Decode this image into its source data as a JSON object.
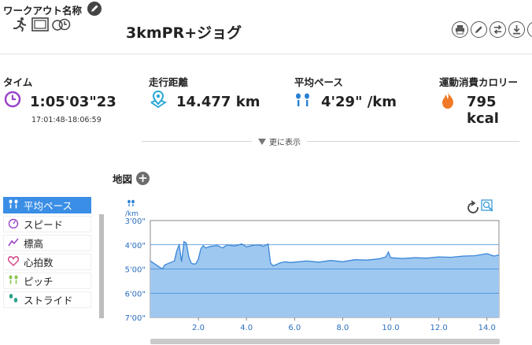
{
  "header": {
    "workout_name_label": "ワークアウト名称",
    "title": "3kmPR+ジョグ",
    "type_icons": [
      "runner-icon",
      "film-icon",
      "stopwatch-icon"
    ],
    "actions": [
      "print-icon",
      "edit-icon",
      "swap-icon",
      "download-icon",
      "share-icon"
    ]
  },
  "stats": {
    "time": {
      "label": "タイム",
      "value": "1:05'03\"23",
      "sub": "17:01:48-18:06:59",
      "icon": "clock-icon"
    },
    "distance": {
      "label": "走行距離",
      "value": "14.477 km",
      "icon": "map-pin-icon"
    },
    "pace": {
      "label": "平均ペース",
      "value": "4'29\" /km",
      "icon": "footprints-icon"
    },
    "calories": {
      "label": "運動消費カロリー",
      "value": "795 kcal",
      "icon": "flame-icon"
    }
  },
  "more_label": "更に表示",
  "map_label": "地図",
  "sidebar": {
    "items": [
      {
        "label": "平均ペース",
        "icon": "footprints-icon",
        "active": true
      },
      {
        "label": "スピード",
        "icon": "speedometer-icon",
        "active": false
      },
      {
        "label": "標高",
        "icon": "elevation-icon",
        "active": false
      },
      {
        "label": "心拍数",
        "icon": "heart-icon",
        "active": false
      },
      {
        "label": "ピッチ",
        "icon": "footprints-icon",
        "active": false
      },
      {
        "label": "ストライド",
        "icon": "stride-icon",
        "active": false
      }
    ]
  },
  "colors": {
    "accent": "#3a8ee6",
    "fill": "#9fc8f0",
    "line": "#3a86d8",
    "purple": "#9a45c8",
    "orange": "#f07a28"
  },
  "chart_data": {
    "type": "area",
    "unit_label": "/km",
    "yticks": [
      "3'00\"",
      "4'00\"",
      "5'00\"",
      "6'00\"",
      "7'00\""
    ],
    "xticks": [
      "2.0",
      "4.0",
      "6.0",
      "8.0",
      "10.0",
      "12.0",
      "14.0"
    ],
    "xlim": [
      0,
      14.5
    ],
    "ylim_seconds_per_km": [
      180,
      420
    ],
    "grid": true,
    "x_km": [
      0.0,
      0.3,
      0.5,
      0.6,
      0.8,
      1.0,
      1.1,
      1.2,
      1.3,
      1.4,
      1.5,
      1.6,
      1.7,
      1.8,
      1.9,
      2.0,
      2.1,
      2.2,
      2.3,
      2.5,
      2.8,
      3.0,
      3.2,
      3.5,
      3.8,
      4.0,
      4.3,
      4.5,
      4.7,
      4.9,
      5.0,
      5.1,
      5.2,
      5.4,
      5.6,
      5.8,
      6.0,
      6.5,
      7.0,
      7.5,
      8.0,
      8.5,
      9.0,
      9.5,
      9.8,
      9.9,
      10.0,
      10.5,
      11.0,
      11.5,
      12.0,
      12.5,
      13.0,
      13.5,
      14.0,
      14.3,
      14.5
    ],
    "pace_seconds_per_km": [
      280,
      292,
      300,
      290,
      285,
      280,
      255,
      240,
      282,
      232,
      236,
      270,
      285,
      288,
      287,
      275,
      250,
      242,
      248,
      244,
      242,
      248,
      240,
      243,
      238,
      245,
      241,
      240,
      244,
      238,
      285,
      292,
      290,
      285,
      282,
      284,
      283,
      280,
      283,
      279,
      282,
      277,
      278,
      275,
      270,
      258,
      272,
      274,
      272,
      273,
      270,
      271,
      268,
      267,
      262,
      268,
      265
    ]
  }
}
